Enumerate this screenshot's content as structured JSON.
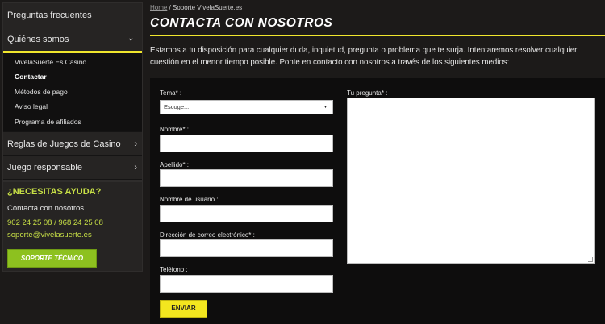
{
  "sidebar": {
    "top_items": [
      {
        "label": "Preguntas frecuentes"
      },
      {
        "label": "Quiénes somos"
      }
    ],
    "sub_items": [
      {
        "label": "VivelaSuerte.Es Casino"
      },
      {
        "label": "Contactar"
      },
      {
        "label": "Métodos de pago"
      },
      {
        "label": "Aviso legal"
      },
      {
        "label": "Programa de afiliados"
      }
    ],
    "bottom_items": [
      {
        "label": "Reglas de Juegos de Casino"
      },
      {
        "label": "Juego responsable"
      }
    ]
  },
  "help": {
    "title": "¿NECESITAS AYUDA?",
    "contact_text": "Contacta con nosotros",
    "phones": "902 24 25 08 / 968 24 25 08",
    "email": "soporte@vivelasuerte.es",
    "button_label": "SOPORTE TÉCNICO"
  },
  "breadcrumb": {
    "home": "Home",
    "separator": " / ",
    "current": "Soporte VivelaSuerte.es"
  },
  "page_title": "CONTACTA CON NOSOTROS",
  "intro": "Estamos a tu disposición para cualquier duda, inquietud, pregunta o problema que te surja. Intentaremos resolver cualquier cuestión en el menor tiempo posible. Ponte en contacto con nosotros a través de los siguientes medios:",
  "form": {
    "tema_label": "Tema* :",
    "tema_value": "Escoge...",
    "nombre_label": "Nombre* :",
    "apellido_label": "Apellido* :",
    "usuario_label": "Nombre de usuario :",
    "email_label": "Dirección de correo electrónico* :",
    "telefono_label": "Teléfono :",
    "pregunta_label": "Tu pregunta* :",
    "submit_label": "ENVIAR"
  },
  "colors": {
    "accent_yellow": "#f0e62d",
    "accent_green": "#8dc11f",
    "help_green": "#c8e046",
    "background": "#1c1a19"
  },
  "icons": {
    "chevron": "chevron-right-icon",
    "chevron_open": "chevron-down-icon",
    "select_caret": "caret-down-icon"
  }
}
